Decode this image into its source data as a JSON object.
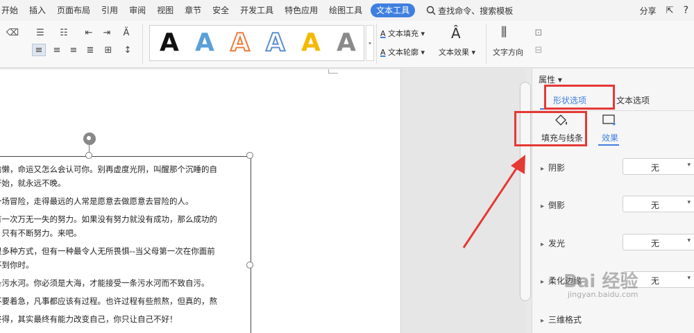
{
  "menubar": {
    "tabs": [
      "开始",
      "插入",
      "页面布局",
      "引用",
      "审阅",
      "视图",
      "章节",
      "安全",
      "开发工具",
      "特色应用",
      "绘图工具",
      "文本工具"
    ],
    "active_tab": "文本工具",
    "search_label": "查找命令、搜索模板",
    "share_label": "分享"
  },
  "ribbon": {
    "text_fill": "文本填充",
    "text_outline": "文本轮廓",
    "text_effects": "文本效果",
    "text_direction": "文字方向",
    "art_styles": [
      {
        "glyph": "A",
        "fill": "#111111",
        "stroke": "none"
      },
      {
        "glyph": "A",
        "fill": "#5aa0d8",
        "stroke": "none"
      },
      {
        "glyph": "A",
        "fill": "#ffffff",
        "stroke": "#ee7b3a"
      },
      {
        "glyph": "A",
        "fill": "#ffffff",
        "stroke": "#5b8fd1"
      },
      {
        "glyph": "A",
        "fill": "#f5b800",
        "stroke": "none"
      },
      {
        "glyph": "A",
        "fill": "#8a8a8a",
        "stroke": "none"
      }
    ]
  },
  "document": {
    "paragraphs": [
      [
        "偷懒，命运又怎么会认可你。别再虚度光阴，叫醒那个沉睡的自",
        "开始，就永远不晚。"
      ],
      [
        "一场冒险，走得最远的人常是愿意去做愿意去冒险的人。"
      ],
      [
        "有一次万无一失的努力。如果没有努力就没有成功，那么成功的",
        "，只有不断努力。来吧。"
      ],
      [
        "很多种方式，但有一种最令人无所畏惧--当父母第一次在你面前",
        "不到你时。"
      ],
      [
        "条污水河。你必须是大海，才能接受一条污水河而不致自污。"
      ],
      [
        "不要着急，凡事都应该有过程。也许过程有些煎熬，但真的，熬"
      ],
      [
        "终得，其实最终有能力改变自己，你只让自己不好！"
      ]
    ]
  },
  "panel": {
    "title": "属性",
    "tab_shape": "形状选项",
    "tab_text": "文本选项",
    "subtab_fill": "填充与线条",
    "subtab_effect": "效果",
    "rows": [
      {
        "label": "阴影",
        "value": "无"
      },
      {
        "label": "倒影",
        "value": "无"
      },
      {
        "label": "发光",
        "value": "无"
      },
      {
        "label": "柔化边缘",
        "value": "无"
      },
      {
        "label": "三维格式",
        "value": ""
      }
    ]
  },
  "watermark": {
    "main": "Bai 经验",
    "sub": "jingyan.baidu.com"
  },
  "colors": {
    "accent": "#3f7fe0",
    "annotation": "#e53935"
  }
}
